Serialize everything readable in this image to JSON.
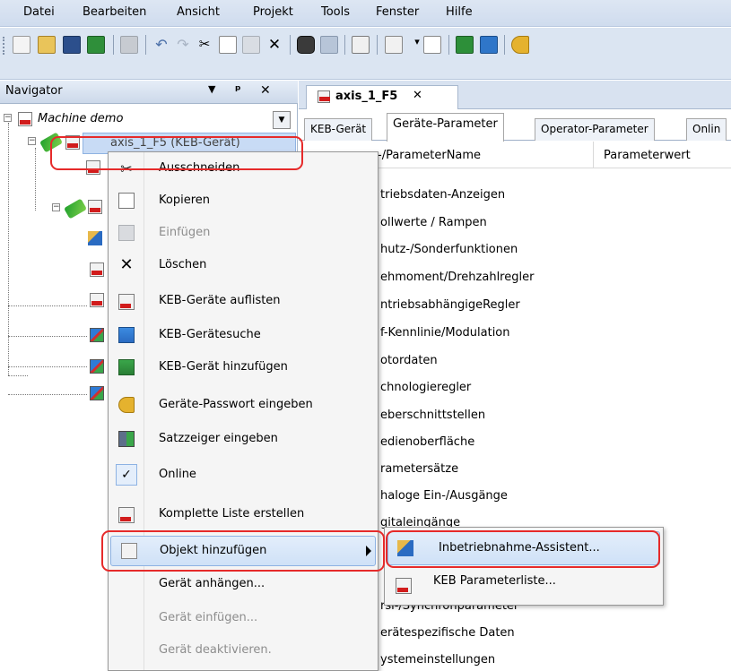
{
  "menubar": {
    "items": [
      "Datei",
      "Bearbeiten",
      "Ansicht",
      "Projekt",
      "Tools",
      "Fenster",
      "Hilfe"
    ]
  },
  "navigator": {
    "title": "Navigator",
    "tree": {
      "root_label": "Machine demo",
      "selected_label": "axis_1_F5 (KEB-Gerät)"
    }
  },
  "editor": {
    "tab_title": "axis_1_F5",
    "subtabs": [
      "KEB-Gerät",
      "Geräte-Parameter",
      "Operator-Parameter",
      "Onlin"
    ],
    "active_subtab": "Geräte-Parameter",
    "columns": {
      "name": "-/ParameterName",
      "value": "Parameterwert"
    },
    "rows": [
      "triebsdaten-Anzeigen",
      "ollwerte / Rampen",
      "hutz-/Sonderfunktionen",
      "ehmoment/Drehzahlregler",
      "ntriebsabhängigeRegler",
      "f-Kennlinie/Modulation",
      "otordaten",
      "chnologieregler",
      "eberschnittstellen",
      "edienoberfläche",
      "rametersätze",
      "haloge Ein-/Ausgänge",
      "gitaleingänge",
      "",
      "",
      "rsi-/Synchronparameter",
      "erätespezifische Daten",
      "ystemeinstellungen"
    ]
  },
  "context_menu": {
    "items": [
      {
        "label": "Ausschneiden",
        "icon": "scissors-icon",
        "disabled": false
      },
      {
        "label": "Kopieren",
        "icon": "copy-icon",
        "disabled": false
      },
      {
        "label": "Einfügen",
        "icon": "paste-icon",
        "disabled": true
      },
      {
        "label": "Löschen",
        "icon": "delete-x-icon",
        "disabled": false
      },
      {
        "label": "KEB-Geräte auflisten",
        "icon": "keb-list-icon",
        "disabled": false
      },
      {
        "label": "KEB-Gerätesuche",
        "icon": "keb-search-icon",
        "disabled": false
      },
      {
        "label": "KEB-Gerät hinzufügen",
        "icon": "keb-add-icon",
        "disabled": false
      },
      {
        "label": "Geräte-Passwort eingeben",
        "icon": "key-icon",
        "disabled": false
      },
      {
        "label": "Satzzeiger eingeben",
        "icon": "record-pointer-icon",
        "disabled": false
      },
      {
        "label": "Online",
        "icon": "checkmark-icon",
        "disabled": false
      },
      {
        "label": "Komplette Liste erstellen",
        "icon": "keb-list-document-icon",
        "disabled": false
      },
      {
        "label": "Objekt hinzufügen",
        "icon": "add-object-icon",
        "disabled": false
      },
      {
        "label": "Gerät anhängen...",
        "icon": "",
        "disabled": false
      },
      {
        "label": "Gerät einfügen...",
        "icon": "",
        "disabled": true
      },
      {
        "label": "Gerät deaktivieren.",
        "icon": "",
        "disabled": true
      }
    ]
  },
  "submenu": {
    "items": [
      {
        "label": "Inbetriebnahme-Assistent...",
        "icon": "wizard-wand-icon"
      },
      {
        "label": "KEB Parameterliste...",
        "icon": "keb-parameter-list-icon"
      }
    ]
  },
  "colors": {
    "highlight_red": "#e62a2a",
    "menu_hover": "#cfe1f7",
    "keb_red": "#d11c1c",
    "chrome_blue": "#dbe5f2"
  }
}
